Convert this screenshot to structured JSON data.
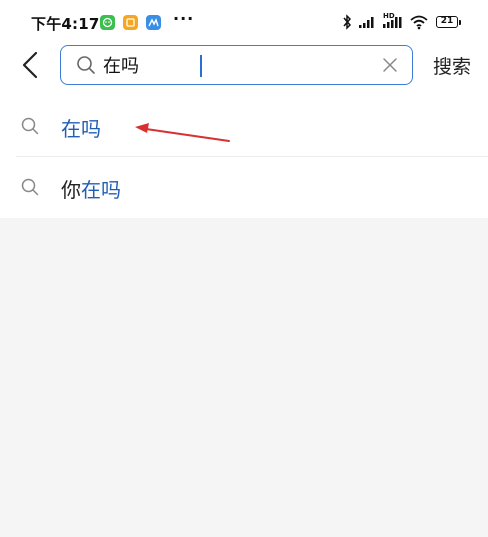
{
  "status_bar": {
    "time": "下午4:17",
    "more_indicator": "···",
    "network_label": "HD",
    "battery_level": "21"
  },
  "search": {
    "query": "在吗",
    "action_label": "搜索"
  },
  "suggestions": [
    {
      "highlight": "在吗",
      "prefix": ""
    },
    {
      "prefix": "你",
      "highlight": "在吗"
    }
  ],
  "colors": {
    "accent": "#3d7fd8",
    "highlight_text": "#1f5fb4",
    "annotation_arrow": "#d93030",
    "page_background": "#f5f5f5"
  },
  "icons": [
    "back-arrow-icon",
    "search-icon",
    "clear-icon",
    "bluetooth-icon",
    "signal-icon",
    "wifi-icon",
    "battery-icon"
  ]
}
